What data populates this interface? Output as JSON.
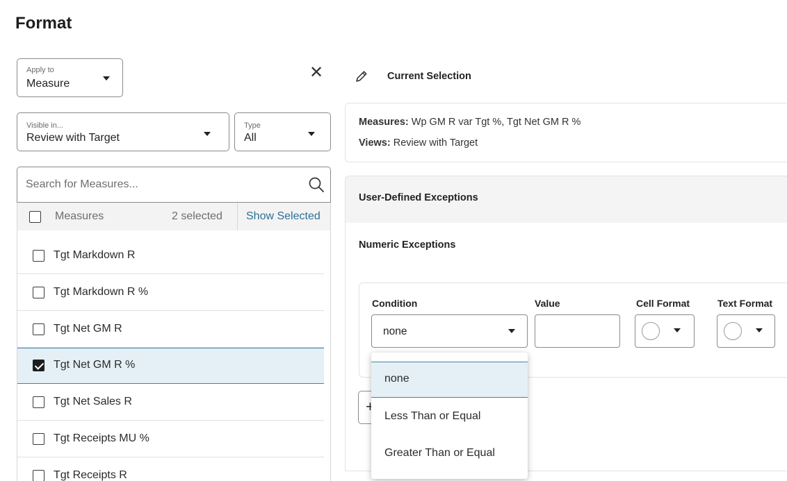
{
  "page": {
    "title": "Format"
  },
  "apply_to": {
    "label": "Apply to",
    "value": "Measure"
  },
  "visible_in": {
    "label": "Visible in...",
    "value": "Review with Target"
  },
  "type": {
    "label": "Type",
    "value": "All"
  },
  "search": {
    "placeholder": "Search for Measures..."
  },
  "list": {
    "header_label": "Measures",
    "selected_count": "2 selected",
    "show_selected": "Show Selected",
    "items": [
      {
        "label": "Tgt Markdown R",
        "checked": false
      },
      {
        "label": "Tgt Markdown R %",
        "checked": false
      },
      {
        "label": "Tgt Net GM R",
        "checked": false
      },
      {
        "label": "Tgt Net GM R %",
        "checked": true
      },
      {
        "label": "Tgt Net Sales R",
        "checked": false
      },
      {
        "label": "Tgt Receipts MU %",
        "checked": false
      },
      {
        "label": "Tgt Receipts R",
        "checked": false
      }
    ]
  },
  "current_selection": {
    "title": "Current Selection",
    "measures_label": "Measures:",
    "measures_value": "Wp GM R var Tgt %, Tgt Net GM R %",
    "views_label": "Views:",
    "views_value": "Review with Target"
  },
  "user_defined": {
    "title": "User-Defined Exceptions"
  },
  "numeric": {
    "title": "Numeric Exceptions",
    "condition_label": "Condition",
    "condition_value": "none",
    "value_label": "Value",
    "value_input": "",
    "cell_format_label": "Cell Format",
    "text_format_label": "Text Format"
  },
  "condition_options": [
    "none",
    "Less Than or Equal",
    "Greater Than or Equal"
  ],
  "colors": {
    "accent": "#4a7ea0",
    "link": "#2d7096",
    "selected_bg": "#e4f0f5"
  }
}
